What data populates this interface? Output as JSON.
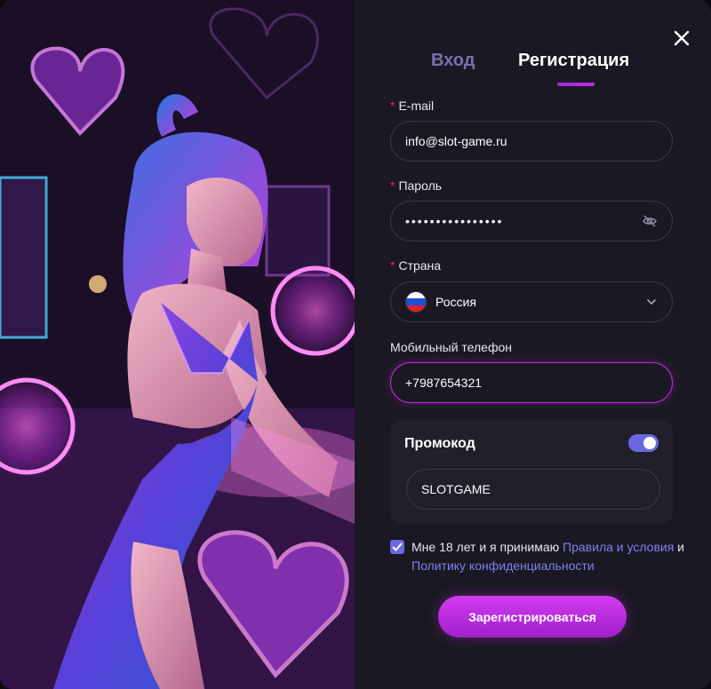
{
  "tabs": {
    "login": "Вход",
    "register": "Регистрация"
  },
  "form": {
    "email": {
      "label": "E-mail",
      "value": "info@slot-game.ru",
      "required": true
    },
    "password": {
      "label": "Пароль",
      "value": "••••••••••••••••",
      "required": true
    },
    "country": {
      "label": "Страна",
      "value": "Россия",
      "required": true
    },
    "phone": {
      "label": "Мобильный телефон",
      "value": "+7987654321",
      "required": false
    }
  },
  "promo": {
    "title": "Промокод",
    "enabled": true,
    "value": "SLOTGAME"
  },
  "agreement": {
    "checked": true,
    "text_before": "Мне 18 лет и я принимаю ",
    "link_rules": "Правила и условия",
    "text_and": " и ",
    "link_privacy": "Политику конфиденциальности"
  },
  "submit_label": "Зарегистрироваться",
  "colors": {
    "accent": "#c12be0",
    "link": "#7e82f0",
    "toggle": "#6a67e0",
    "required": "#e0304a"
  },
  "icons": [
    "close-icon",
    "eye-off-icon",
    "chevron-down-icon",
    "russia-flag-icon",
    "check-icon"
  ]
}
